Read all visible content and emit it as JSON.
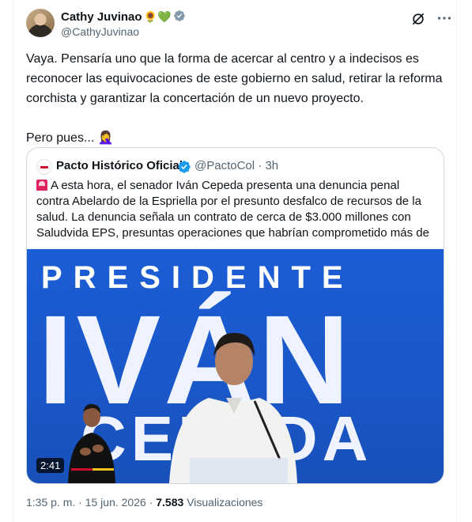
{
  "author": {
    "name": "Cathy Juvinao",
    "emojis": "🌻💚",
    "handle": "@CathyJuvinao"
  },
  "tweet": {
    "paragraph1": "Vaya. Pensaría uno que la forma de acercar al centro y a indecisos es reconocer las equivocaciones de este gobierno en salud, retirar la reforma corchista y garantizar la concertación de un nuevo proyecto.",
    "paragraph2": "Pero pues... 🤦‍♀️"
  },
  "quote": {
    "name": "Pacto Histórico Oficial",
    "handle": "@PactoCol",
    "separator": "·",
    "time": "3h",
    "text": "A esta hora, el senador Iván Cepeda presenta una denuncia penal contra Abelardo de la Espriella por el presunto desfalco de recursos de la salud. La denuncia señala un contrato de cerca de $3.000 millones con Saludvida EPS, presuntas operaciones que habrían comprometido más de",
    "media": {
      "title": "PRESIDENTE",
      "name": "IVÁN",
      "last": "CEPEDA",
      "duration": "2:41"
    }
  },
  "meta": {
    "time": "1:35 p. m.",
    "separator": "·",
    "date": "15 jun. 2026",
    "views_count": "7.583",
    "views_label": "Visualizaciones"
  },
  "colors": {
    "verified_blue": "#1d9bf0",
    "verified_grey": "#829aab",
    "media_blue": "#1b5dd6",
    "secondary_text": "#536471"
  },
  "icons": [
    "grok-icon",
    "more-icon",
    "verified-badge-icon",
    "siren-icon"
  ]
}
